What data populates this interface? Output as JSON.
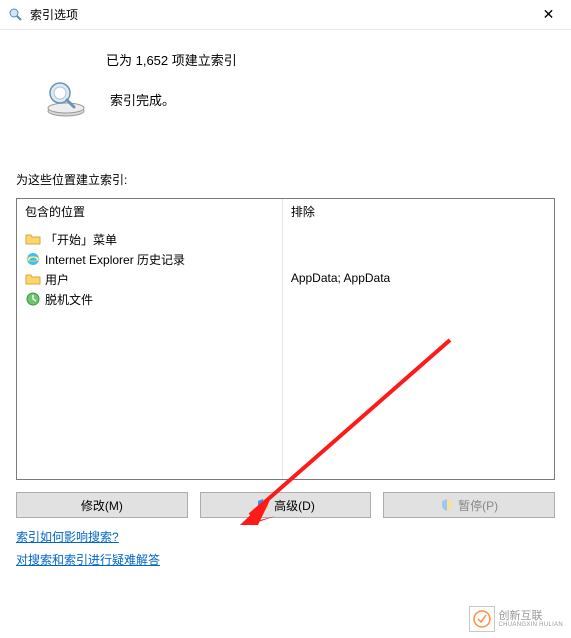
{
  "window": {
    "title": "索引选项",
    "close_label": "✕"
  },
  "status": {
    "count_text": "已为 1,652 项建立索引",
    "complete_text": "索引完成。"
  },
  "section_label": "为这些位置建立索引:",
  "columns": {
    "included_header": "包含的位置",
    "excluded_header": "排除"
  },
  "included_items": [
    {
      "icon": "folder",
      "label": "「开始」菜单"
    },
    {
      "icon": "ie",
      "label": "Internet Explorer 历史记录"
    },
    {
      "icon": "folder",
      "label": "用户"
    },
    {
      "icon": "offline",
      "label": "脱机文件"
    }
  ],
  "excluded_text": "AppData; AppData",
  "buttons": {
    "modify": "修改(M)",
    "advanced": "高级(D)",
    "pause": "暂停(P)"
  },
  "links": {
    "how_affects": "索引如何影响搜索?",
    "troubleshoot": "对搜索和索引进行疑难解答"
  },
  "watermark": {
    "brand": "创新互联",
    "sub": "CHUANGXIN HULIAN"
  }
}
